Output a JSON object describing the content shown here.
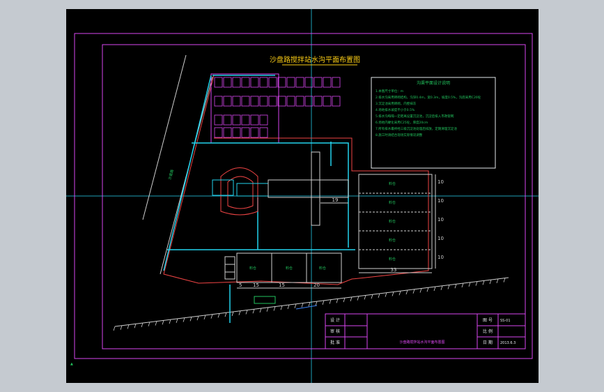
{
  "drawing": {
    "title": "沙盘路搅拌站水沟平面布置图",
    "notes_title": "沟渠平面设计说明",
    "notes_lines": [
      "1.本图尺寸单位：m",
      "2.排水沟采用砖砌结构，沟深0.4m，宽0.3m，坡度0.5%，沟底采用C20砼",
      "3.沉淀池采用砖砌，内壁抹灰",
      "4.场地排水坡度不小于0.5%",
      "5.排水沟每隔一定距离设置沉淀池，沉淀后排入市政管网",
      "6.场地内硬化采用C25砼，厚度20cm",
      "7.所有排水最终经三级沉淀池处理后排放，定期清理沉淀池",
      "8.施工时请结合现场实际情况调整"
    ],
    "dimensions": {
      "d19": "19",
      "d33": "33",
      "d5": "5",
      "d15a": "15",
      "d15b": "15",
      "d20": "20",
      "d10a": "10",
      "d10b": "10",
      "d10c": "10",
      "d10d": "10",
      "d10e": "10"
    },
    "zones": [
      "料仓",
      "料仓",
      "料仓",
      "料仓",
      "料仓"
    ],
    "bottom_zones": [
      "料仓",
      "料仓",
      "料仓"
    ],
    "road_label": "沙盘路",
    "title_block": {
      "design_label": "设 计",
      "check_label": "审 核",
      "approve_label": "批 准",
      "drawing_no_label": "图 号",
      "drawing_no": "SS-01",
      "scale_label": "比 例",
      "scale": "",
      "date_label": "日 期",
      "date": "2013.6.3",
      "sheet_title": "沙盘路搅拌站水沟平面布置图"
    }
  },
  "colors": {
    "frame": "#d946ef",
    "ditch": "#22d3ee",
    "text": "#22c55e",
    "boundary": "#ef4444",
    "road": "#cfcfcf"
  }
}
